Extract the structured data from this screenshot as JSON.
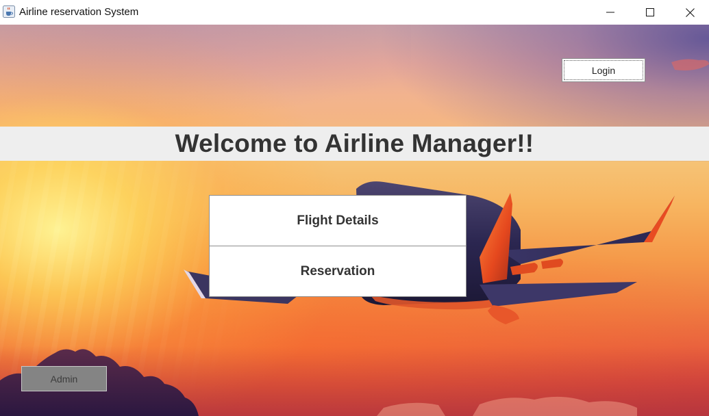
{
  "window": {
    "title": "Airline reservation System",
    "icon": "java-cup-icon",
    "controls": [
      "minimize-icon",
      "maximize-icon",
      "close-icon"
    ]
  },
  "header": {
    "login_label": "Login"
  },
  "banner": {
    "text": "Welcome to Airline Manager!!"
  },
  "menu": {
    "flight_details_label": "Flight Details",
    "reservation_label": "Reservation"
  },
  "footer": {
    "admin_label": "Admin"
  },
  "colors": {
    "banner_bg": "#eeeeee",
    "banner_text": "#333333",
    "button_bg": "#ffffff",
    "admin_bg": "#848484"
  }
}
